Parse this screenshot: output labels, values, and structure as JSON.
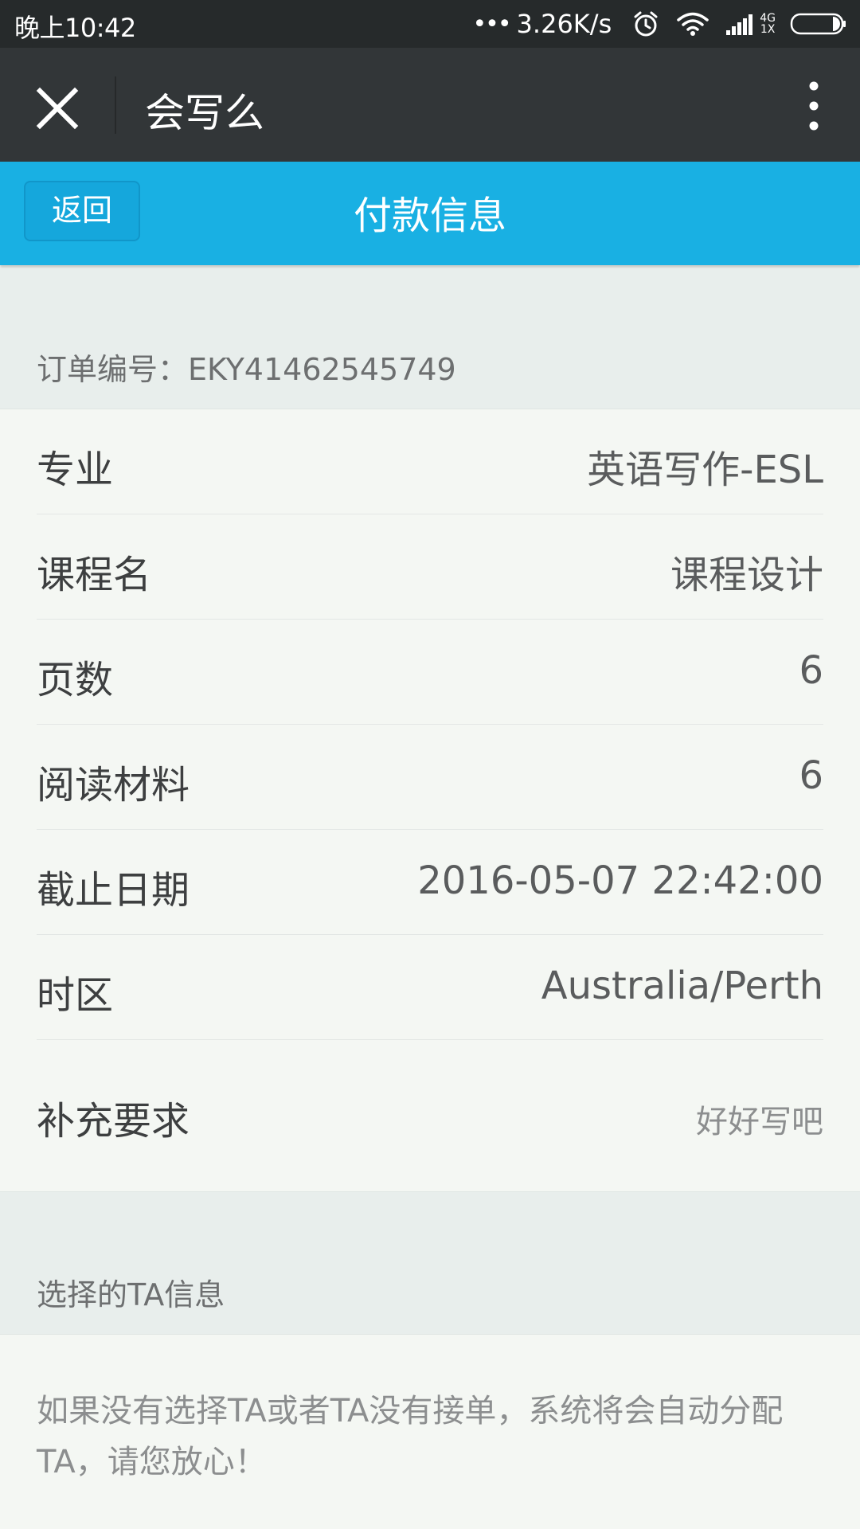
{
  "status_bar": {
    "time": "晚上10:42",
    "dots": "•••",
    "speed": "3.26K/s",
    "network_top": "4G",
    "network_bottom": "1X"
  },
  "app_bar": {
    "title": "会写么"
  },
  "header": {
    "back_label": "返回",
    "title": "付款信息"
  },
  "order": {
    "label": "订单编号：EKY41462545749"
  },
  "details": [
    {
      "label": "专业",
      "value": "英语写作-ESL"
    },
    {
      "label": "课程名",
      "value": "课程设计"
    },
    {
      "label": "页数",
      "value": "6"
    },
    {
      "label": "阅读材料",
      "value": "6"
    },
    {
      "label": "截止日期",
      "value": "2016-05-07 22:42:00"
    },
    {
      "label": "时区",
      "value": "Australia/Perth"
    },
    {
      "label": "补充要求",
      "value": "好好写吧"
    }
  ],
  "ta_section": {
    "label": "选择的TA信息",
    "notice": "如果没有选择TA或者TA没有接单，系统将会自动分配TA，请您放心！"
  },
  "colors": {
    "status_bar_bg": "#262a2b",
    "app_bar_bg": "#323638",
    "header_bg": "#19b0e3",
    "section_bg": "#e8eeec",
    "content_bg": "#f4f7f3"
  }
}
